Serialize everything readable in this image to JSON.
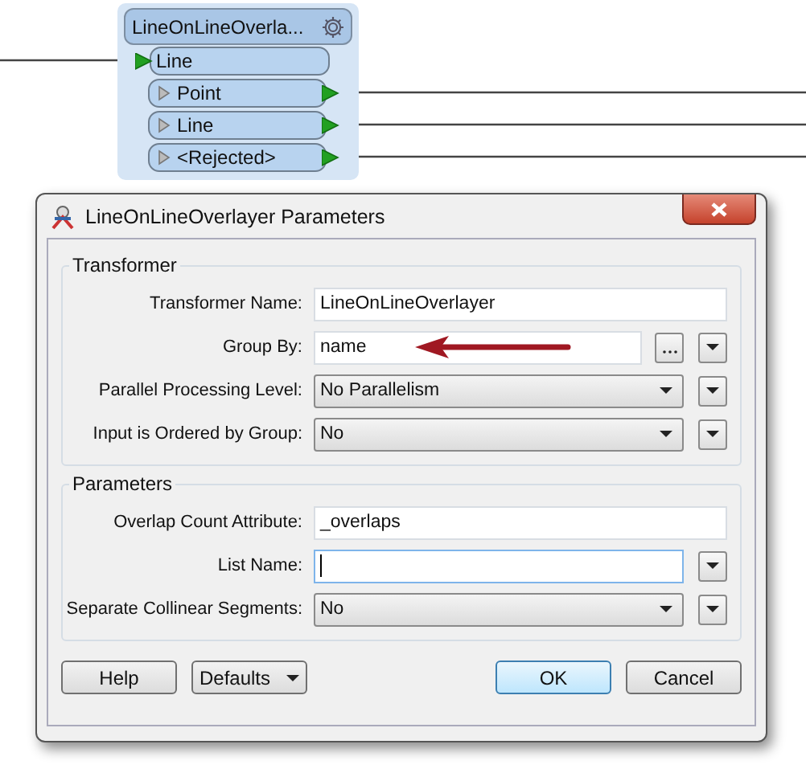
{
  "node": {
    "title": "LineOnLineOverla...",
    "input_ports": [
      {
        "label": "Line"
      }
    ],
    "output_ports": [
      {
        "label": "Point"
      },
      {
        "label": "Line"
      },
      {
        "label": "<Rejected>"
      }
    ]
  },
  "dialog": {
    "title": "LineOnLineOverlayer Parameters",
    "groups": [
      {
        "title": "Transformer",
        "fields": [
          {
            "label": "Transformer Name:",
            "kind": "text",
            "value": "LineOnLineOverlayer",
            "focused": false
          },
          {
            "label": "Group By:",
            "kind": "text",
            "value": "name",
            "side_buttons": [
              {
                "kind": "browse"
              },
              {
                "kind": "menu"
              }
            ],
            "focused": false
          },
          {
            "label": "Parallel Processing Level:",
            "kind": "select",
            "value": "No Parallelism",
            "side_buttons": [
              {
                "kind": "menu"
              }
            ]
          },
          {
            "label": "Input is Ordered by Group:",
            "kind": "select",
            "value": "No",
            "side_buttons": [
              {
                "kind": "menu"
              }
            ]
          }
        ]
      },
      {
        "title": "Parameters",
        "fields": [
          {
            "label": "Overlap Count Attribute:",
            "kind": "text",
            "value": "_overlaps",
            "focused": false
          },
          {
            "label": "List Name:",
            "kind": "text",
            "side_buttons": [
              {
                "kind": "menu"
              }
            ],
            "focused": true
          },
          {
            "label": "Separate Collinear Segments:",
            "kind": "select",
            "value": "No",
            "side_buttons": [
              {
                "kind": "menu"
              }
            ]
          }
        ]
      }
    ],
    "buttons": [
      {
        "label": "Help",
        "kind": "plain",
        "default": false
      },
      {
        "label": "Defaults",
        "kind": "menu",
        "default": false
      },
      {
        "label": "OK",
        "kind": "plain",
        "default": true
      },
      {
        "label": "Cancel",
        "kind": "plain",
        "default": false
      }
    ]
  }
}
